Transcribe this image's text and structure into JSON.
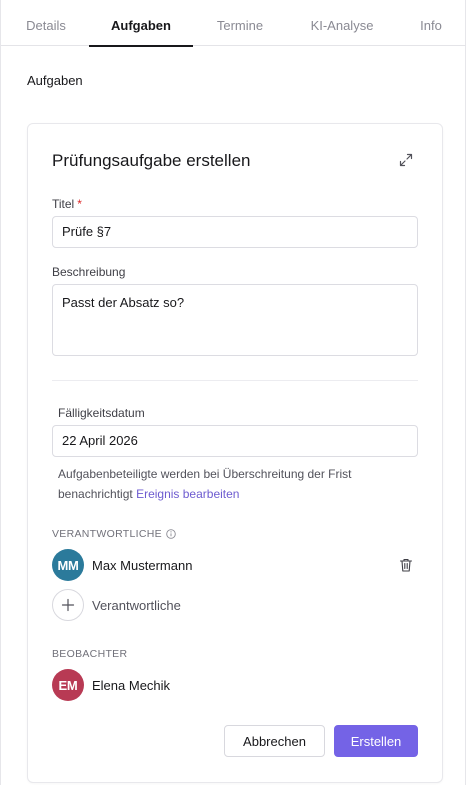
{
  "tabs": [
    {
      "label": "Details",
      "active": false
    },
    {
      "label": "Aufgaben",
      "active": true
    },
    {
      "label": "Termine",
      "active": false
    },
    {
      "label": "KI-Analyse",
      "active": false
    },
    {
      "label": "Info",
      "active": false
    }
  ],
  "section_title": "Aufgaben",
  "form": {
    "title": "Prüfungsaufgabe erstellen",
    "titel_label": "Titel",
    "required_marker": "*",
    "titel_value": "Prüfe §7",
    "beschreibung_label": "Beschreibung",
    "beschreibung_value": "Passt der Absatz so?",
    "due_label": "Fälligkeitsdatum",
    "due_value": "22 April 2026",
    "hint_text": "Aufgabenbeteiligte werden bei Überschreitung der Frist benachrichtigt",
    "hint_link": "Ereignis bearbeiten",
    "responsible_label": "VERANTWORTLICHE",
    "responsible": [
      {
        "initials": "MM",
        "name": "Max Mustermann",
        "color": "#2b7a9b"
      }
    ],
    "add_responsible_label": "Verantwortliche",
    "observers_label": "BEOBACHTER",
    "observers": [
      {
        "initials": "EM",
        "name": "Elena Mechik",
        "color": "#b83a54"
      }
    ],
    "cancel_label": "Abbrechen",
    "submit_label": "Erstellen"
  },
  "colors": {
    "accent": "#7463e6",
    "link": "#6d5bd0",
    "required": "#dc2626"
  },
  "icons": {
    "expand": "expand-icon",
    "info": "info-icon",
    "trash": "trash-icon",
    "plus": "plus-icon"
  }
}
